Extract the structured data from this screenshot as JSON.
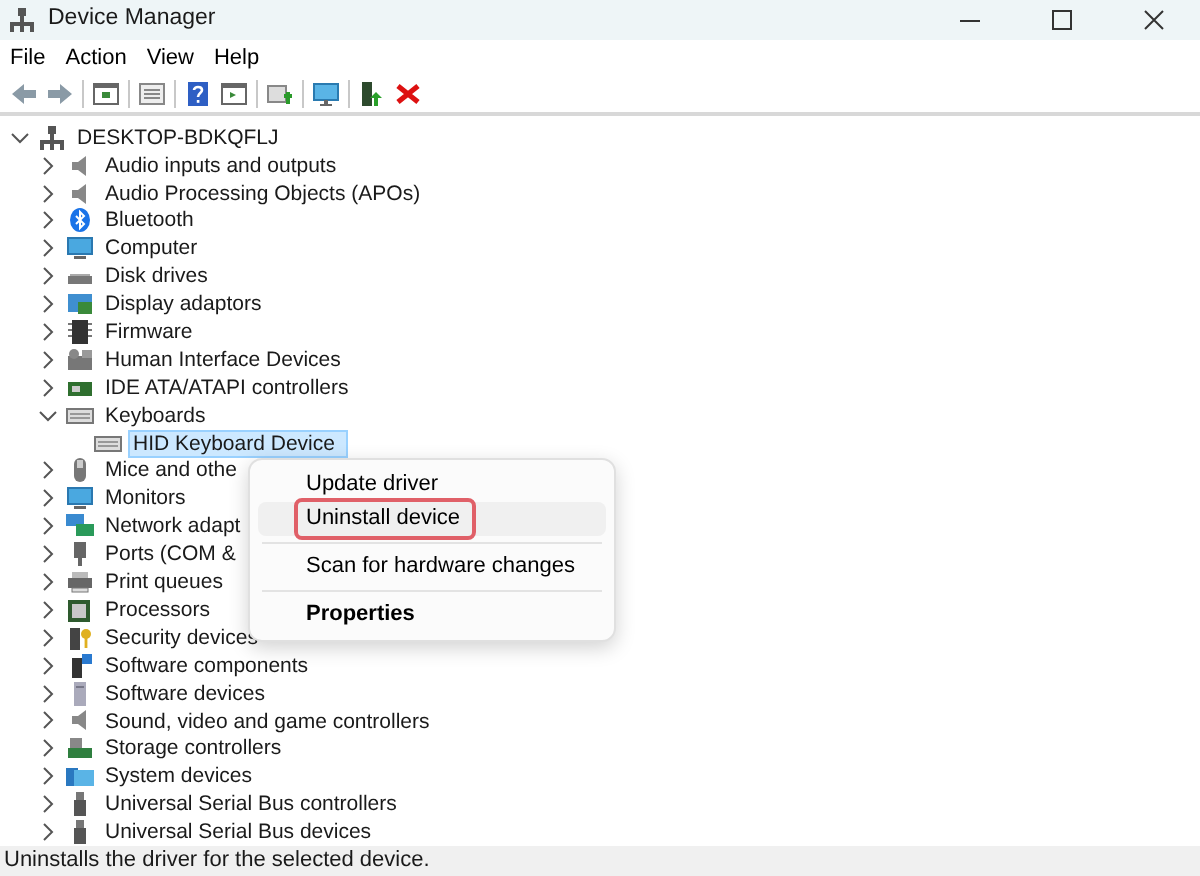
{
  "window": {
    "title": "Device Manager"
  },
  "menu_bar": [
    "File",
    "Action",
    "View",
    "Help"
  ],
  "tree": {
    "label": "DESKTOP-BDKQFLJ",
    "expanded": true,
    "selected": false,
    "children": [
      {
        "label": "Audio inputs and outputs",
        "expanded": false,
        "selected": false
      },
      {
        "label": "Audio Processing Objects (APOs)",
        "expanded": false,
        "selected": false
      },
      {
        "label": "Bluetooth",
        "expanded": false,
        "selected": false
      },
      {
        "label": "Computer",
        "expanded": false,
        "selected": false
      },
      {
        "label": "Disk drives",
        "expanded": false,
        "selected": false
      },
      {
        "label": "Display adaptors",
        "expanded": false,
        "selected": false
      },
      {
        "label": "Firmware",
        "expanded": false,
        "selected": false
      },
      {
        "label": "Human Interface Devices",
        "expanded": false,
        "selected": false
      },
      {
        "label": "IDE ATA/ATAPI controllers",
        "expanded": false,
        "selected": false
      },
      {
        "label": "Keyboards",
        "expanded": true,
        "selected": false,
        "children": [
          {
            "label": "HID Keyboard Device",
            "selected": true
          }
        ]
      },
      {
        "label": "Mice and othe",
        "expanded": false,
        "selected": false
      },
      {
        "label": "Monitors",
        "expanded": false,
        "selected": false
      },
      {
        "label": "Network adapt",
        "expanded": false,
        "selected": false
      },
      {
        "label": "Ports (COM &",
        "expanded": false,
        "selected": false
      },
      {
        "label": "Print queues",
        "expanded": false,
        "selected": false
      },
      {
        "label": "Processors",
        "expanded": false,
        "selected": false
      },
      {
        "label": "Security devices",
        "expanded": false,
        "selected": false
      },
      {
        "label": "Software components",
        "expanded": false,
        "selected": false
      },
      {
        "label": "Software devices",
        "expanded": false,
        "selected": false
      },
      {
        "label": "Sound, video and game controllers",
        "expanded": false,
        "selected": false
      },
      {
        "label": "Storage controllers",
        "expanded": false,
        "selected": false
      },
      {
        "label": "System devices",
        "expanded": false,
        "selected": false
      },
      {
        "label": "Universal Serial Bus controllers",
        "expanded": false,
        "selected": false
      },
      {
        "label": "Universal Serial Bus devices",
        "expanded": false,
        "selected": false
      }
    ]
  },
  "context_menu": [
    {
      "kind": "item",
      "label": "Update driver",
      "highlighted": false,
      "outlined": false,
      "default": false
    },
    {
      "kind": "item",
      "label": "Uninstall device",
      "highlighted": true,
      "outlined": true,
      "default": false
    },
    {
      "kind": "separator"
    },
    {
      "kind": "item",
      "label": "Scan for hardware changes",
      "highlighted": false,
      "outlined": false,
      "default": false
    },
    {
      "kind": "separator"
    },
    {
      "kind": "item",
      "label": "Properties",
      "highlighted": false,
      "outlined": false,
      "default": true
    }
  ],
  "status_bar": "Uninstalls the driver for the selected device."
}
